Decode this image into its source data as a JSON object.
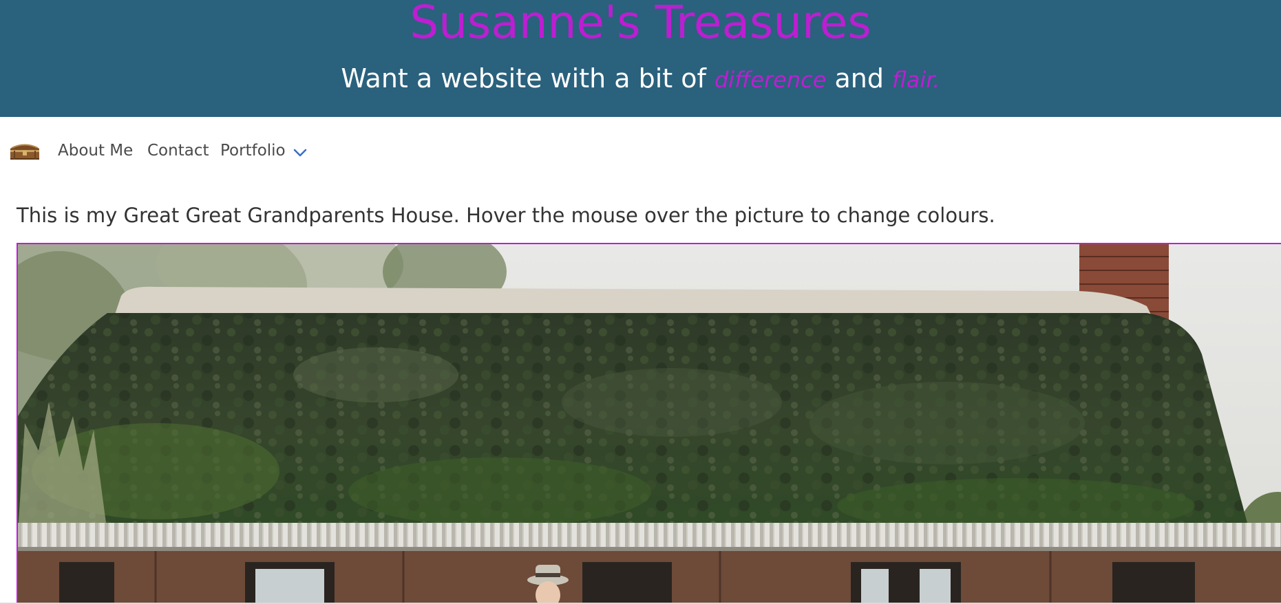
{
  "header": {
    "site_title": "Susanne's Treasures",
    "tagline_start": "Want a website with a bit of ",
    "tagline_accent_1": "difference",
    "tagline_middle": " and ",
    "tagline_accent_2": "flair."
  },
  "nav": {
    "brand_icon": "treasure-chest-icon",
    "items": [
      {
        "label": "About Me"
      },
      {
        "label": "Contact"
      },
      {
        "label": "Portfolio",
        "has_dropdown": true
      }
    ]
  },
  "main": {
    "intro_text": "This is my Great Great Grandparents House. Hover the mouse over the picture to change colours.",
    "photo_alt": "Great Great Grandparents House"
  },
  "colors": {
    "banner_bg": "#2a617d",
    "accent_magenta": "#bd1ed2",
    "nav_text": "#4a4a4a",
    "chevron_blue": "#3a6fc4"
  }
}
